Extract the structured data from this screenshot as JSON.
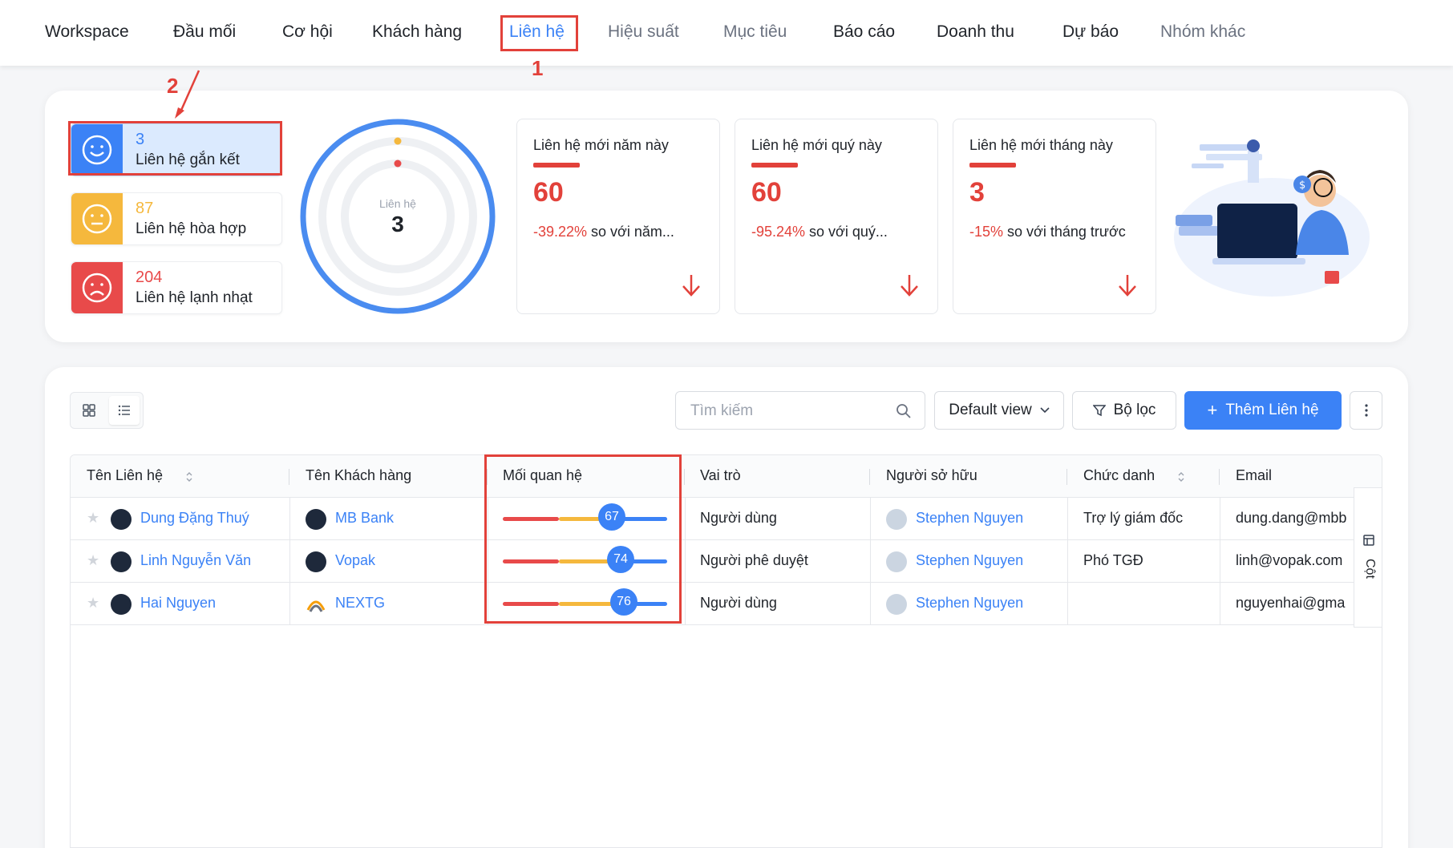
{
  "nav": {
    "items": [
      {
        "label": "Workspace",
        "style": "normal"
      },
      {
        "label": "Đầu mối",
        "style": "normal"
      },
      {
        "label": "Cơ hội",
        "style": "normal"
      },
      {
        "label": "Khách hàng",
        "style": "normal"
      },
      {
        "label": "Liên hệ",
        "style": "active"
      },
      {
        "label": "Hiệu suất",
        "style": "muted"
      },
      {
        "label": "Mục tiêu",
        "style": "muted"
      },
      {
        "label": "Báo cáo",
        "style": "normal"
      },
      {
        "label": "Doanh thu",
        "style": "normal"
      },
      {
        "label": "Dự báo",
        "style": "normal"
      },
      {
        "label": "Nhóm khác",
        "style": "muted"
      }
    ]
  },
  "annotations": {
    "step1": "1",
    "step2": "2"
  },
  "status_cards": [
    {
      "count": "3",
      "label": "Liên hệ gắn kết",
      "color": "#3b82f6",
      "icon": "smile-icon"
    },
    {
      "count": "87",
      "label": "Liên hệ hòa hợp",
      "color": "#f5b83d",
      "icon": "neutral-face-icon"
    },
    {
      "count": "204",
      "label": "Liên hệ lạnh nhạt",
      "color": "#e84a4a",
      "icon": "sad-face-icon"
    }
  ],
  "donut": {
    "label": "Liên hệ",
    "value": "3"
  },
  "stats": [
    {
      "title": "Liên hệ mới năm này",
      "value": "60",
      "pct": "-39.22%",
      "compare": " so với năm..."
    },
    {
      "title": "Liên hệ mới quý này",
      "value": "60",
      "pct": "-95.24%",
      "compare": " so với quý..."
    },
    {
      "title": "Liên hệ mới tháng này",
      "value": "3",
      "pct": "-15%",
      "compare": " so với tháng trước"
    }
  ],
  "toolbar": {
    "search_placeholder": "Tìm kiếm",
    "view_label": "Default view",
    "filter_label": "Bộ lọc",
    "add_label": "Thêm Liên hệ",
    "add_icon": "+"
  },
  "table": {
    "headers": [
      "Tên Liên hệ",
      "Tên Khách hàng",
      "Mối quan hệ",
      "Vai trò",
      "Người sở hữu",
      "Chức danh",
      "Email"
    ],
    "rows": [
      {
        "name": "Dung Đặng Thuý",
        "customer": "MB Bank",
        "relation": 67,
        "role": "Người dùng",
        "owner": "Stephen Nguyen",
        "title": "Trợ lý giám đốc",
        "email": "dung.dang@mbb"
      },
      {
        "name": "Linh Nguyễn Văn",
        "customer": "Vopak",
        "relation": 74,
        "role": "Người phê duyệt",
        "owner": "Stephen Nguyen",
        "title": "Phó TGĐ",
        "email": "linh@vopak.com"
      },
      {
        "name": "Hai Nguyen",
        "customer": "NEXTG",
        "relation": 76,
        "role": "Người dùng",
        "owner": "Stephen Nguyen",
        "title": "",
        "email": "nguyenhai@gma"
      }
    ],
    "column_panel_label": "Cột"
  }
}
